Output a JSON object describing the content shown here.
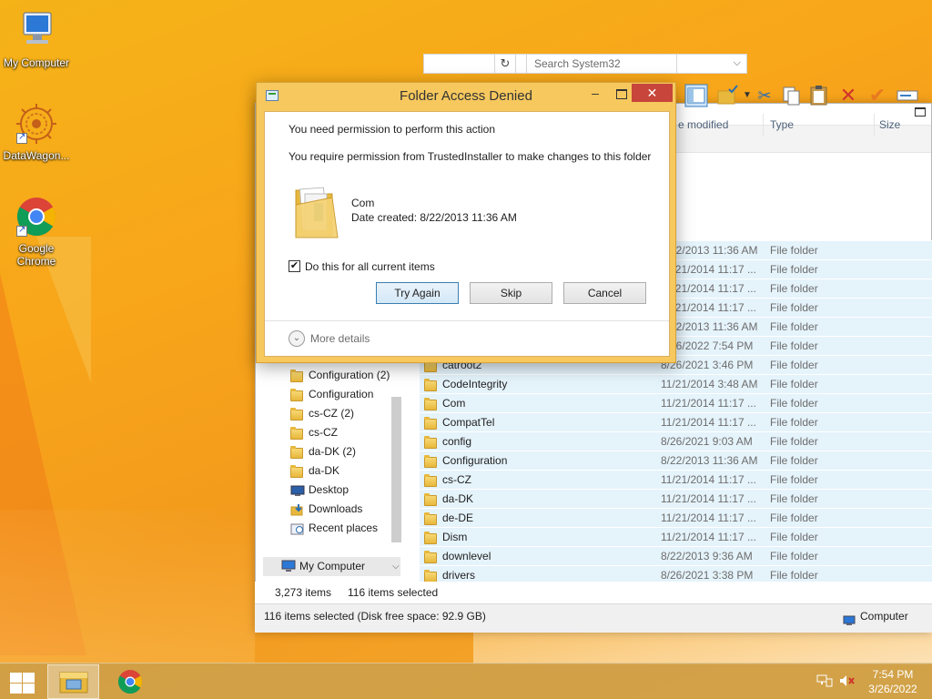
{
  "desktop": {
    "icons": [
      {
        "label": "My Computer"
      },
      {
        "label": "DataWagon..."
      },
      {
        "label": "Google Chrome"
      }
    ]
  },
  "explorer": {
    "search_placeholder": "Search System32",
    "columns": {
      "date": "e modified",
      "type": "Type",
      "size": "Size"
    },
    "files": [
      {
        "name": "",
        "date": "8/22/2013 11:36 AM",
        "type": "File folder"
      },
      {
        "name": "",
        "date": "11/21/2014 11:17 ...",
        "type": "File folder"
      },
      {
        "name": "",
        "date": "11/21/2014 11:17 ...",
        "type": "File folder"
      },
      {
        "name": "",
        "date": "11/21/2014 11:17 ...",
        "type": "File folder"
      },
      {
        "name": "",
        "date": "8/22/2013 11:36 AM",
        "type": "File folder"
      },
      {
        "name": "",
        "date": "3/26/2022 7:54 PM",
        "type": "File folder"
      },
      {
        "name": "catroot2",
        "date": "8/26/2021 3:46 PM",
        "type": "File folder"
      },
      {
        "name": "CodeIntegrity",
        "date": "11/21/2014 3:48 AM",
        "type": "File folder"
      },
      {
        "name": "Com",
        "date": "11/21/2014 11:17 ...",
        "type": "File folder"
      },
      {
        "name": "CompatTel",
        "date": "11/21/2014 11:17 ...",
        "type": "File folder"
      },
      {
        "name": "config",
        "date": "8/26/2021 9:03 AM",
        "type": "File folder"
      },
      {
        "name": "Configuration",
        "date": "8/22/2013 11:36 AM",
        "type": "File folder"
      },
      {
        "name": "cs-CZ",
        "date": "11/21/2014 11:17 ...",
        "type": "File folder"
      },
      {
        "name": "da-DK",
        "date": "11/21/2014 11:17 ...",
        "type": "File folder"
      },
      {
        "name": "de-DE",
        "date": "11/21/2014 11:17 ...",
        "type": "File folder"
      },
      {
        "name": "Dism",
        "date": "11/21/2014 11:17 ...",
        "type": "File folder"
      },
      {
        "name": "downlevel",
        "date": "8/22/2013 9:36 AM",
        "type": "File folder"
      },
      {
        "name": "drivers",
        "date": "8/26/2021 3:38 PM",
        "type": "File folder"
      }
    ],
    "nav": [
      {
        "name": "Configuration (2)",
        "icon": "folder-icon"
      },
      {
        "name": "Configuration",
        "icon": "folder-icon"
      },
      {
        "name": "cs-CZ (2)",
        "icon": "folder-icon"
      },
      {
        "name": "cs-CZ",
        "icon": "folder-icon"
      },
      {
        "name": "da-DK (2)",
        "icon": "folder-icon"
      },
      {
        "name": "da-DK",
        "icon": "folder-icon"
      },
      {
        "name": "Desktop",
        "icon": "desktop-icon"
      },
      {
        "name": "Downloads",
        "icon": "downloads-icon"
      },
      {
        "name": "Recent places",
        "icon": "recent-places-icon"
      }
    ],
    "nav_selected": "My Computer",
    "item_count": "3,273 items",
    "selected_count": "116 items selected",
    "status_text": "116 items selected (Disk free space: 92.9 GB)",
    "status_location": "Computer"
  },
  "dialog": {
    "title": "Folder Access Denied",
    "heading": "You need permission to perform this action",
    "message": "You require permission from TrustedInstaller to make changes to this folder",
    "item_name": "Com",
    "item_date": "Date created: 8/22/2013 11:36 AM",
    "checkbox_label": "Do this for all current items",
    "checkbox_checked": "✔",
    "buttons": {
      "try_again": "Try Again",
      "skip": "Skip",
      "cancel": "Cancel"
    },
    "more_details": "More details"
  },
  "taskbar": {
    "time": "7:54 PM",
    "date": "3/26/2022"
  },
  "colors": {
    "wallpaper": "#f8a51a",
    "dialog_frame": "#f6c85e",
    "close_button": "#c7453a",
    "selection": "#e5f3fb"
  }
}
